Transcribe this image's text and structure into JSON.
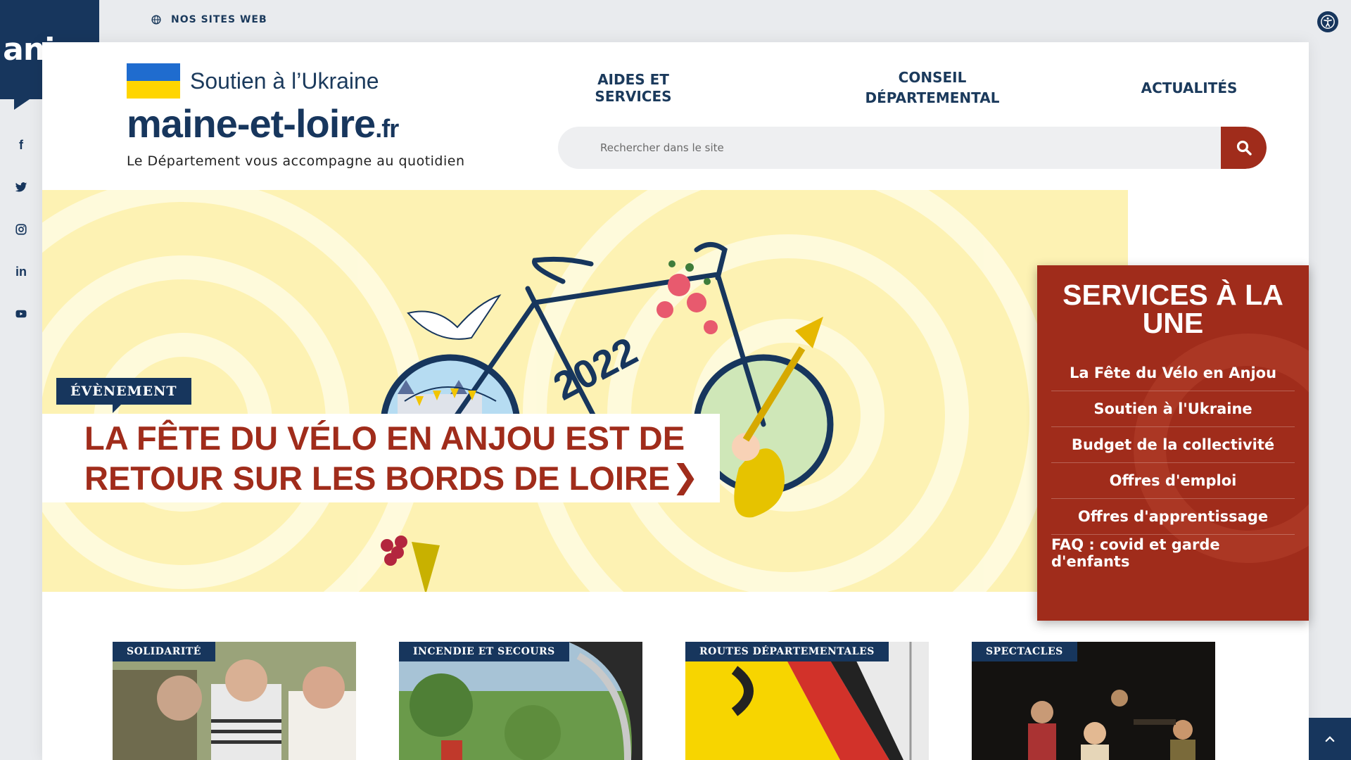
{
  "brand": {
    "logo_text": "anjou"
  },
  "social": [
    {
      "name": "facebook",
      "glyph": "f"
    },
    {
      "name": "twitter",
      "glyph": ""
    },
    {
      "name": "instagram",
      "glyph": ""
    },
    {
      "name": "linkedin",
      "glyph": "in"
    },
    {
      "name": "youtube",
      "glyph": ""
    }
  ],
  "topbar": {
    "sites_label": "NOS SITES WEB"
  },
  "header": {
    "ukraine_label": "Soutien à l’Ukraine",
    "site_name_main": "maine-et-loire",
    "site_name_suffix": ".fr",
    "tagline": "Le Département vous accompagne au quotidien"
  },
  "nav": {
    "aides": "AIDES ET SERVICES",
    "conseil_line1": "CONSEIL",
    "conseil_line2": "DÉPARTEMENTAL",
    "actualites": "ACTUALITÉS"
  },
  "search": {
    "placeholder": "Rechercher dans le site"
  },
  "hero": {
    "tag": "ÉVÈNEMENT",
    "title_line1": "LA FÊTE DU VÉLO EN ANJOU EST DE",
    "title_line2": "RETOUR SUR LES BORDS DE LOIRE",
    "art_year": "2022"
  },
  "services": {
    "title": "SERVICES À LA UNE",
    "items": [
      "La Fête du Vélo en Anjou",
      "Soutien à l'Ukraine",
      "Budget de la collectivité",
      "Offres d'emploi",
      "Offres d'apprentissage",
      "FAQ : covid et garde d'enfants"
    ]
  },
  "cards": [
    {
      "tag": "SOLIDARITÉ"
    },
    {
      "tag": "INCENDIE ET SECOURS"
    },
    {
      "tag": "ROUTES DÉPARTEMENTALES"
    },
    {
      "tag": "SPECTACLES"
    }
  ],
  "colors": {
    "navy": "#17365d",
    "red": "#a02c1b",
    "hero_yellow": "#fdf2b3",
    "ukraine_blue": "#1f6ccf",
    "ukraine_yellow": "#ffd500"
  }
}
